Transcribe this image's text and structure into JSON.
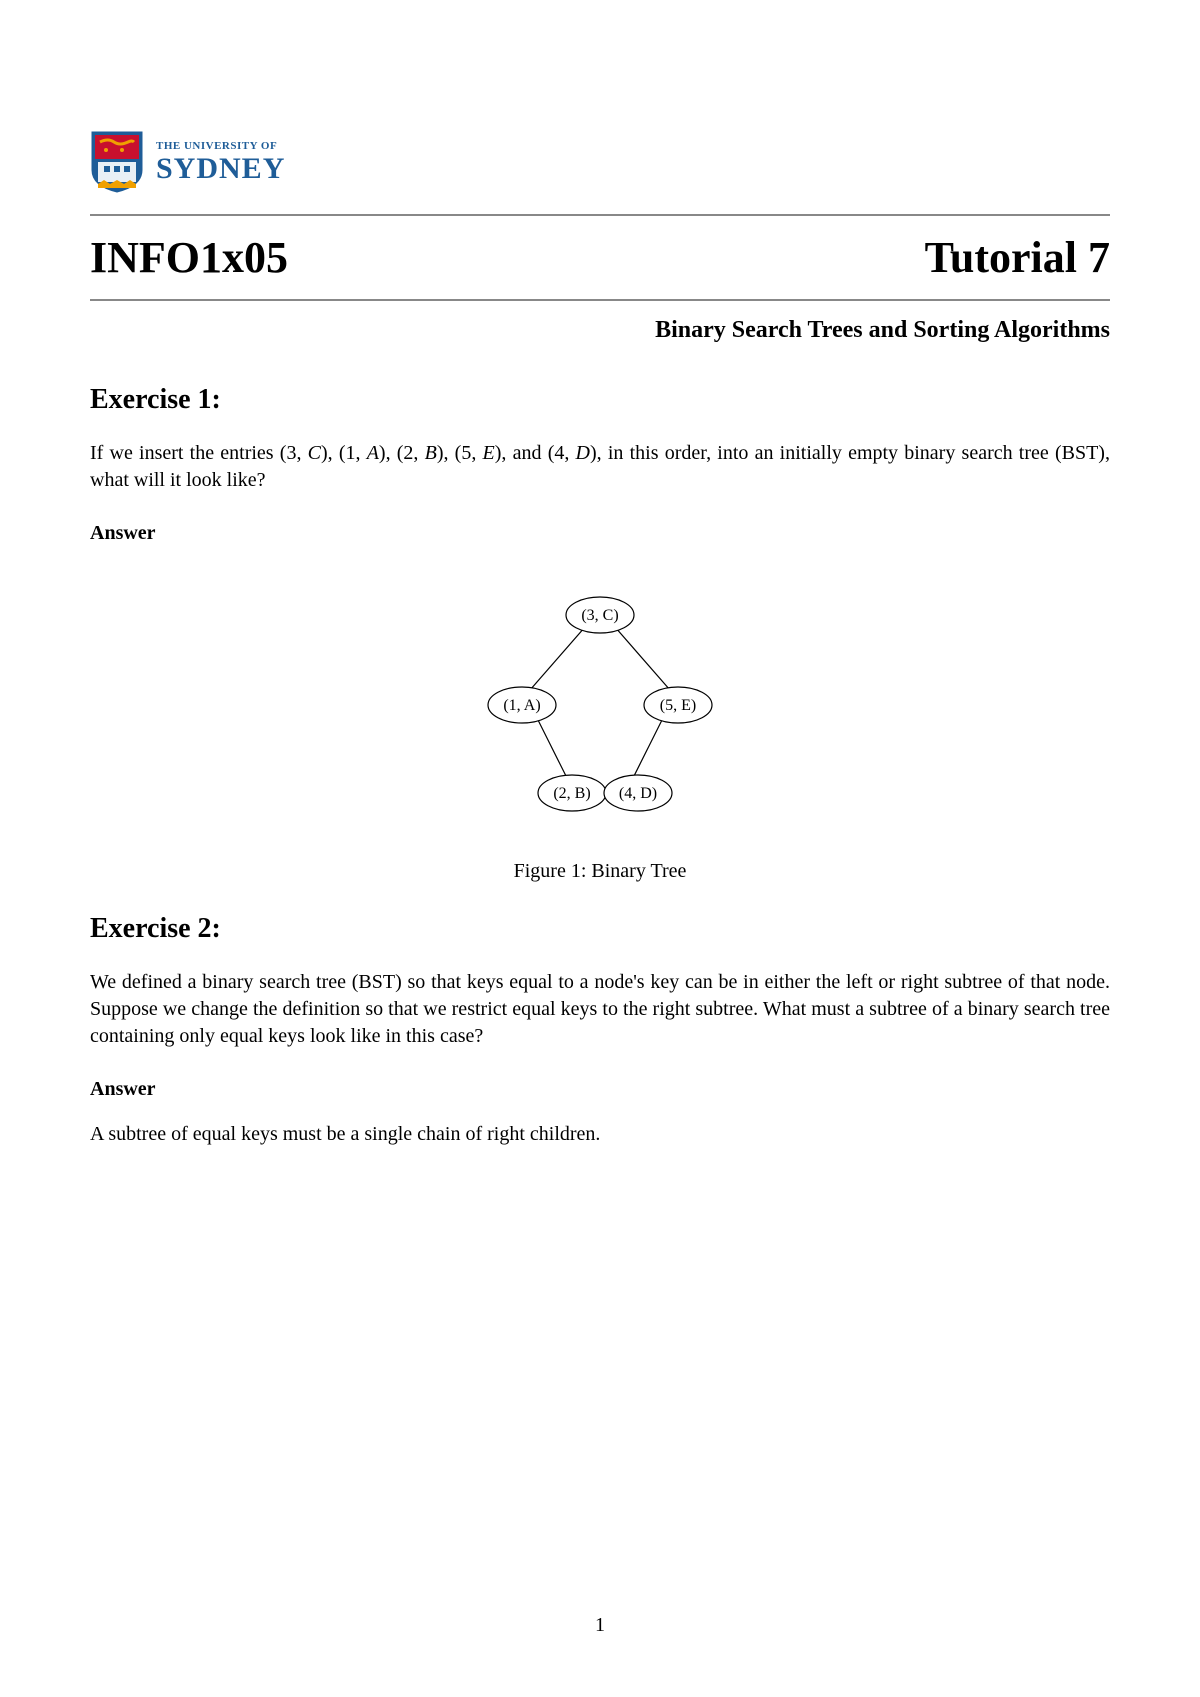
{
  "logo": {
    "line1": "THE UNIVERSITY OF",
    "line2": "SYDNEY"
  },
  "header": {
    "course": "INFO1x05",
    "tutorial": "Tutorial 7"
  },
  "subtitle": "Binary Search Trees and Sorting Algorithms",
  "exercise1": {
    "heading": "Exercise 1:",
    "entries": [
      "(3, C)",
      "(1, A)",
      "(2, B)",
      "(5, E)",
      "(4, D)"
    ],
    "question_prefix": "If we insert the entries ",
    "question_suffix": ", in this order, into an initially empty binary search tree (BST), what will it look like?",
    "answer_label": "Answer",
    "figure_caption": "Figure 1: Binary Tree",
    "tree_nodes": {
      "root": "(3, C)",
      "left": "(1, A)",
      "right": "(5, E)",
      "left_right": "(2, B)",
      "right_left": "(4, D)"
    }
  },
  "exercise2": {
    "heading": "Exercise 2:",
    "question": "We defined a binary search tree (BST) so that keys equal to a node's key can be in either the left or right subtree of that node. Suppose we change the definition so that we restrict equal keys to the right subtree. What must a subtree of a binary search tree containing only equal keys look like in this case?",
    "answer_label": "Answer",
    "answer_text": "A subtree of equal keys must be a single chain of right children."
  },
  "page_number": "1"
}
